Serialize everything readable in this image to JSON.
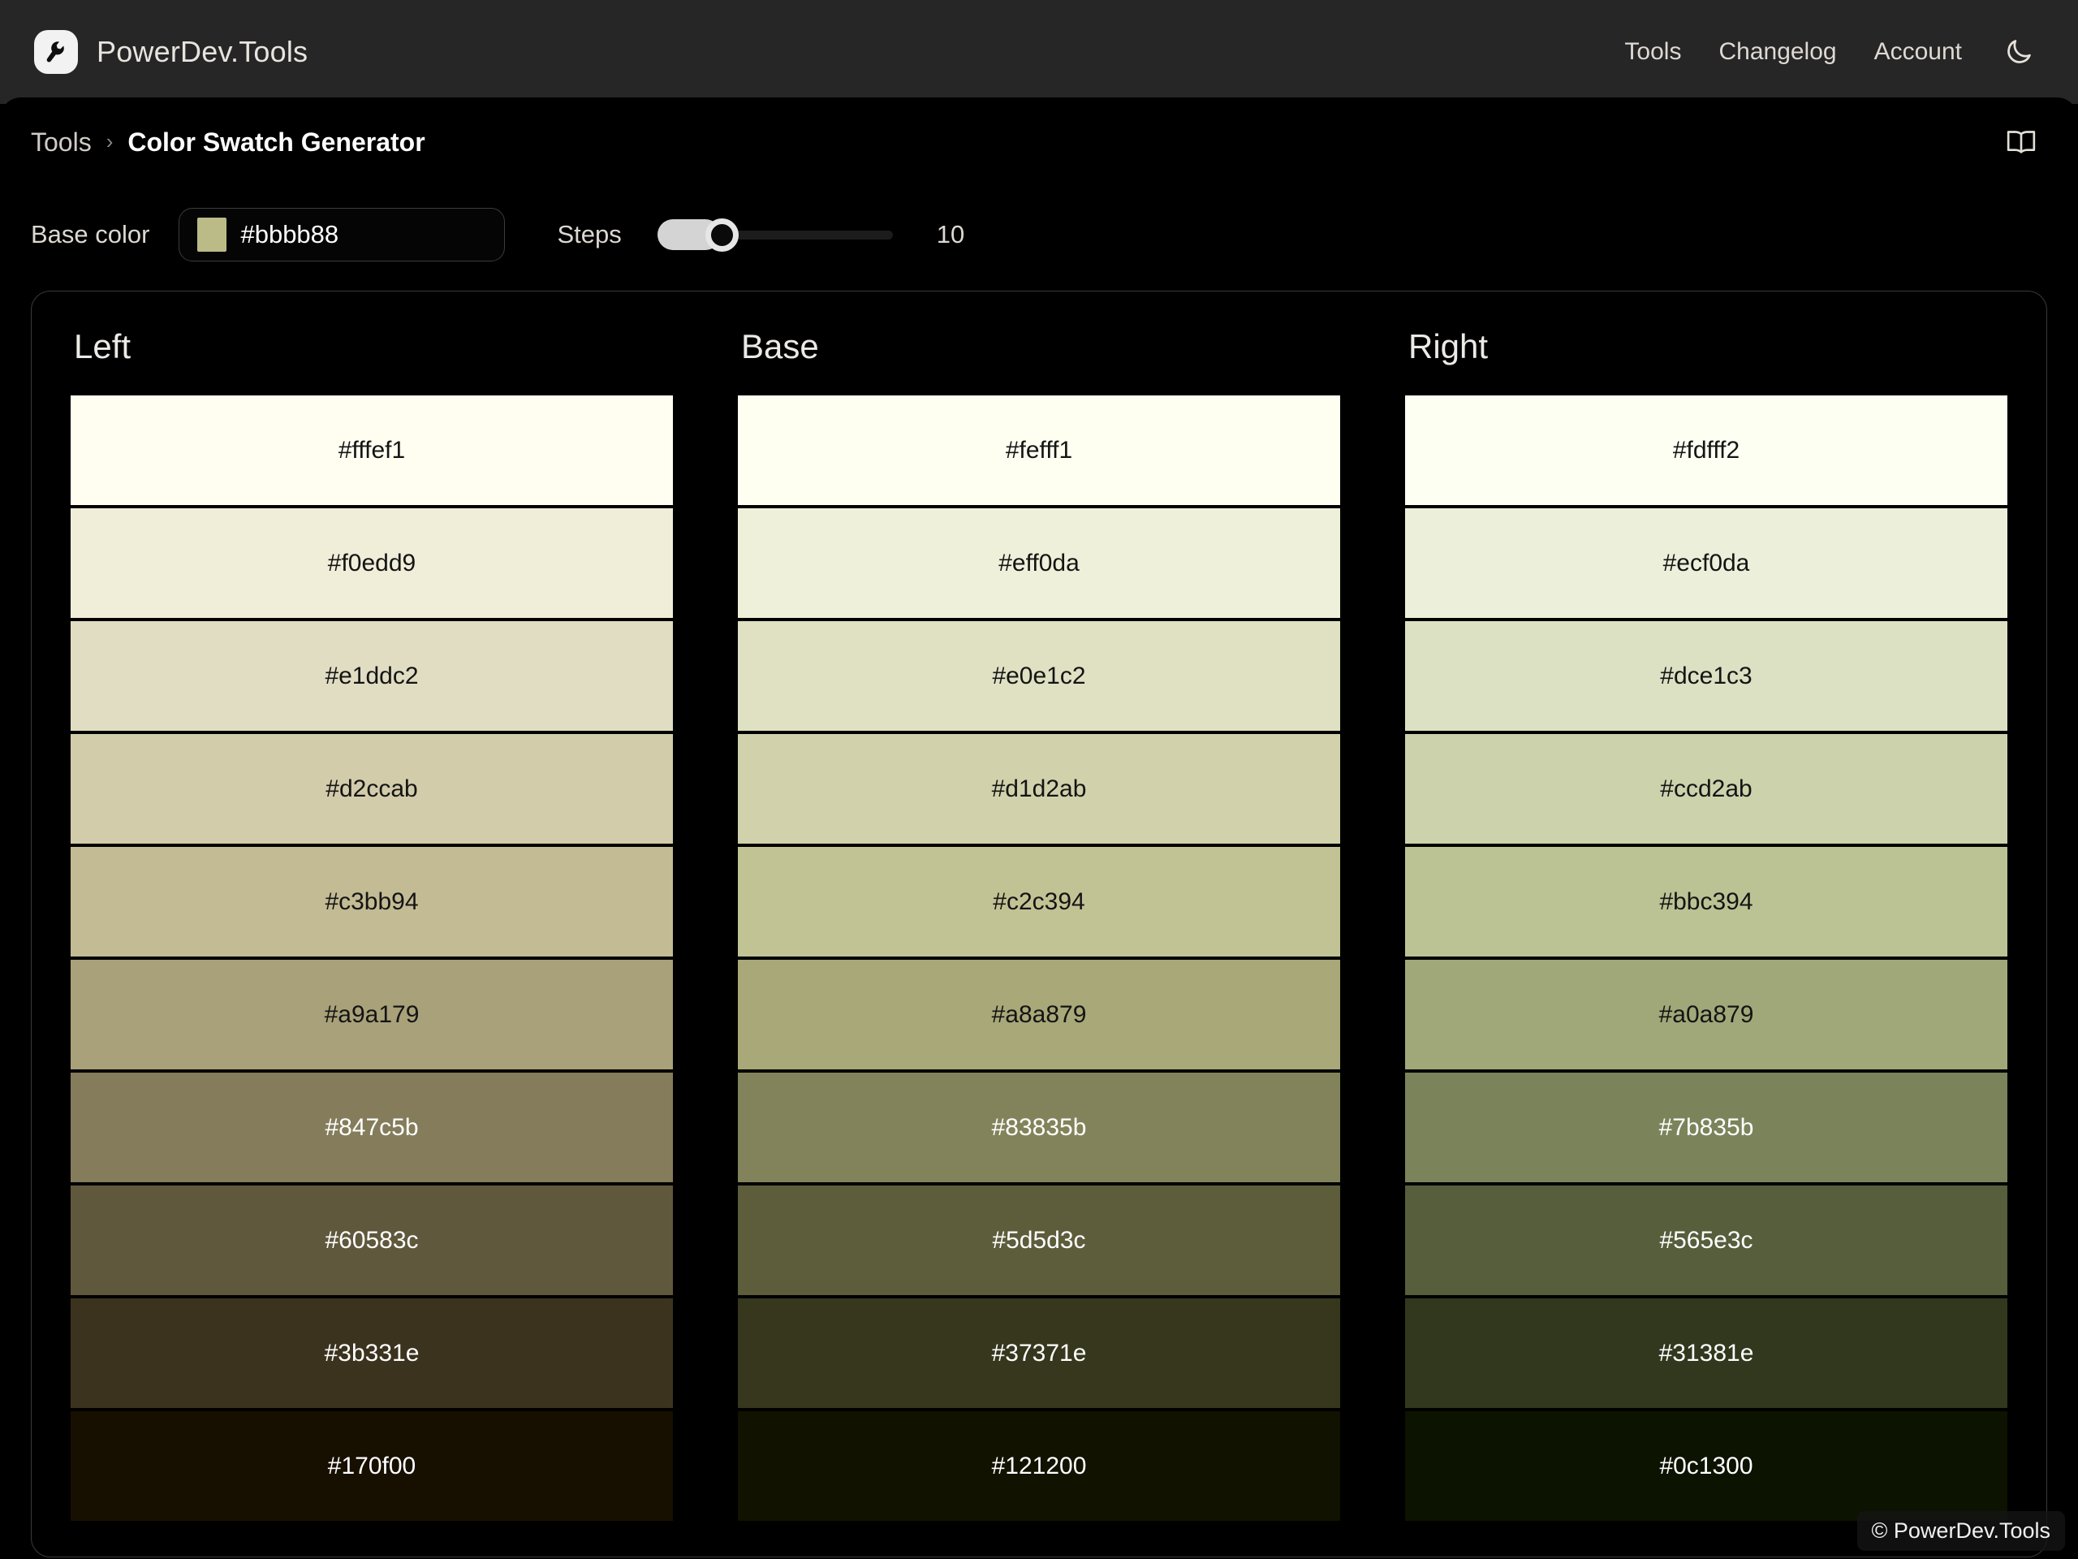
{
  "topbar": {
    "brand_name": "PowerDev.Tools",
    "logo_icon": "wrench-icon",
    "nav": [
      {
        "label": "Tools"
      },
      {
        "label": "Changelog"
      },
      {
        "label": "Account"
      }
    ],
    "theme_toggle_icon": "moon-icon"
  },
  "breadcrumb": {
    "parent": "Tools",
    "separator": "›",
    "current": "Color Swatch Generator",
    "docs_icon": "book-icon"
  },
  "controls": {
    "base_color_label": "Base color",
    "base_color_value": "#bbbb88",
    "base_color_swatch": "#bbbb88",
    "steps_label": "Steps",
    "steps_value": "10",
    "steps_slider_percent": 27
  },
  "chart_data": {
    "type": "table",
    "title": "Color Swatch Generator",
    "columns": [
      "Left",
      "Base",
      "Right"
    ],
    "series": [
      {
        "name": "Left",
        "values": [
          "#fffef1",
          "#f0edd9",
          "#e1ddc2",
          "#d2ccab",
          "#c3bb94",
          "#a9a179",
          "#847c5b",
          "#60583c",
          "#3b331e",
          "#170f00"
        ]
      },
      {
        "name": "Base",
        "values": [
          "#fefff1",
          "#eff0da",
          "#e0e1c2",
          "#d1d2ab",
          "#c2c394",
          "#a8a879",
          "#83835b",
          "#5d5d3c",
          "#37371e",
          "#121200"
        ]
      },
      {
        "name": "Right",
        "values": [
          "#fdfff2",
          "#ecf0da",
          "#dce1c3",
          "#ccd2ab",
          "#bbc394",
          "#a0a879",
          "#7b835b",
          "#565e3c",
          "#31381e",
          "#0c1300"
        ]
      }
    ]
  },
  "watermark": {
    "text": "© PowerDev.Tools"
  },
  "theme": {
    "topbar_bg": "#262626",
    "page_bg": "#000000",
    "accent": "#bbbb88",
    "border": "#3a3a3a"
  }
}
